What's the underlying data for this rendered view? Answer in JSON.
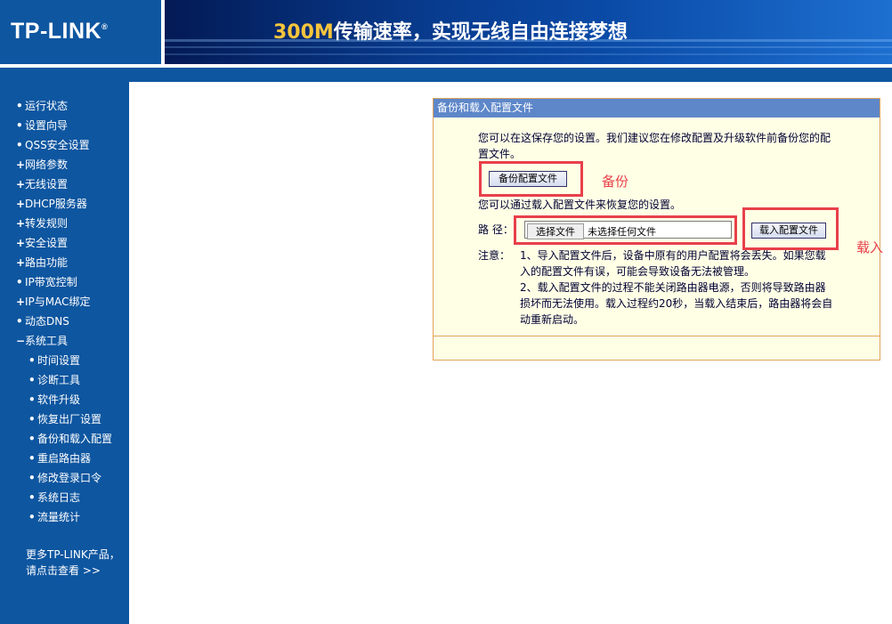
{
  "header": {
    "logo": "TP-LINK",
    "logo_mark": "®",
    "slogan_number": "300M",
    "slogan_text": "传输速率，实现无线自由连接梦想"
  },
  "sidebar": {
    "items": [
      {
        "label": "运行状态",
        "marker": "•"
      },
      {
        "label": "设置向导",
        "marker": "•"
      },
      {
        "label": "QSS安全设置",
        "marker": "•"
      },
      {
        "label": "网络参数",
        "marker": "+"
      },
      {
        "label": "无线设置",
        "marker": "+"
      },
      {
        "label": "DHCP服务器",
        "marker": "+"
      },
      {
        "label": "转发规则",
        "marker": "+"
      },
      {
        "label": "安全设置",
        "marker": "+"
      },
      {
        "label": "路由功能",
        "marker": "+"
      },
      {
        "label": "IP带宽控制",
        "marker": "•"
      },
      {
        "label": "IP与MAC绑定",
        "marker": "+"
      },
      {
        "label": "动态DNS",
        "marker": "•"
      },
      {
        "label": "系统工具",
        "marker": "−"
      }
    ],
    "sub_items": [
      {
        "label": "时间设置",
        "marker": "•"
      },
      {
        "label": "诊断工具",
        "marker": "•"
      },
      {
        "label": "软件升级",
        "marker": "•"
      },
      {
        "label": "恢复出厂设置",
        "marker": "•"
      },
      {
        "label": "备份和载入配置",
        "marker": "•"
      },
      {
        "label": "重启路由器",
        "marker": "•"
      },
      {
        "label": "修改登录口令",
        "marker": "•"
      },
      {
        "label": "系统日志",
        "marker": "•"
      },
      {
        "label": "流量统计",
        "marker": "•"
      }
    ],
    "more_line1": "更多TP-LINK产品，",
    "more_line2": "请点击查看 >>"
  },
  "panel": {
    "title": "备份和载入配置文件",
    "backup_desc": "您可以在这保存您的设置。我们建议您在修改配置及升级软件前备份您的配置文件。",
    "backup_button": "备份配置文件",
    "restore_desc": "您可以通过载入配置文件来恢复您的设置。",
    "path_label": "路 径：",
    "choose_file": "选择文件",
    "no_file": "未选择任何文件",
    "load_button": "载入配置文件",
    "note_label": "注意：",
    "note1": "1、导入配置文件后，设备中原有的用户配置将会丢失。如果您载入的配置文件有误，可能会导致设备无法被管理。",
    "note2": "2、载入配置文件的过程不能关闭路由器电源，否则将导致路由器损坏而无法使用。载入过程约20秒，当载入结束后，路由器将会自动重新启动。"
  },
  "annotations": {
    "backup_label": "备份",
    "load_label": "载入",
    "color": "#e8404a"
  }
}
